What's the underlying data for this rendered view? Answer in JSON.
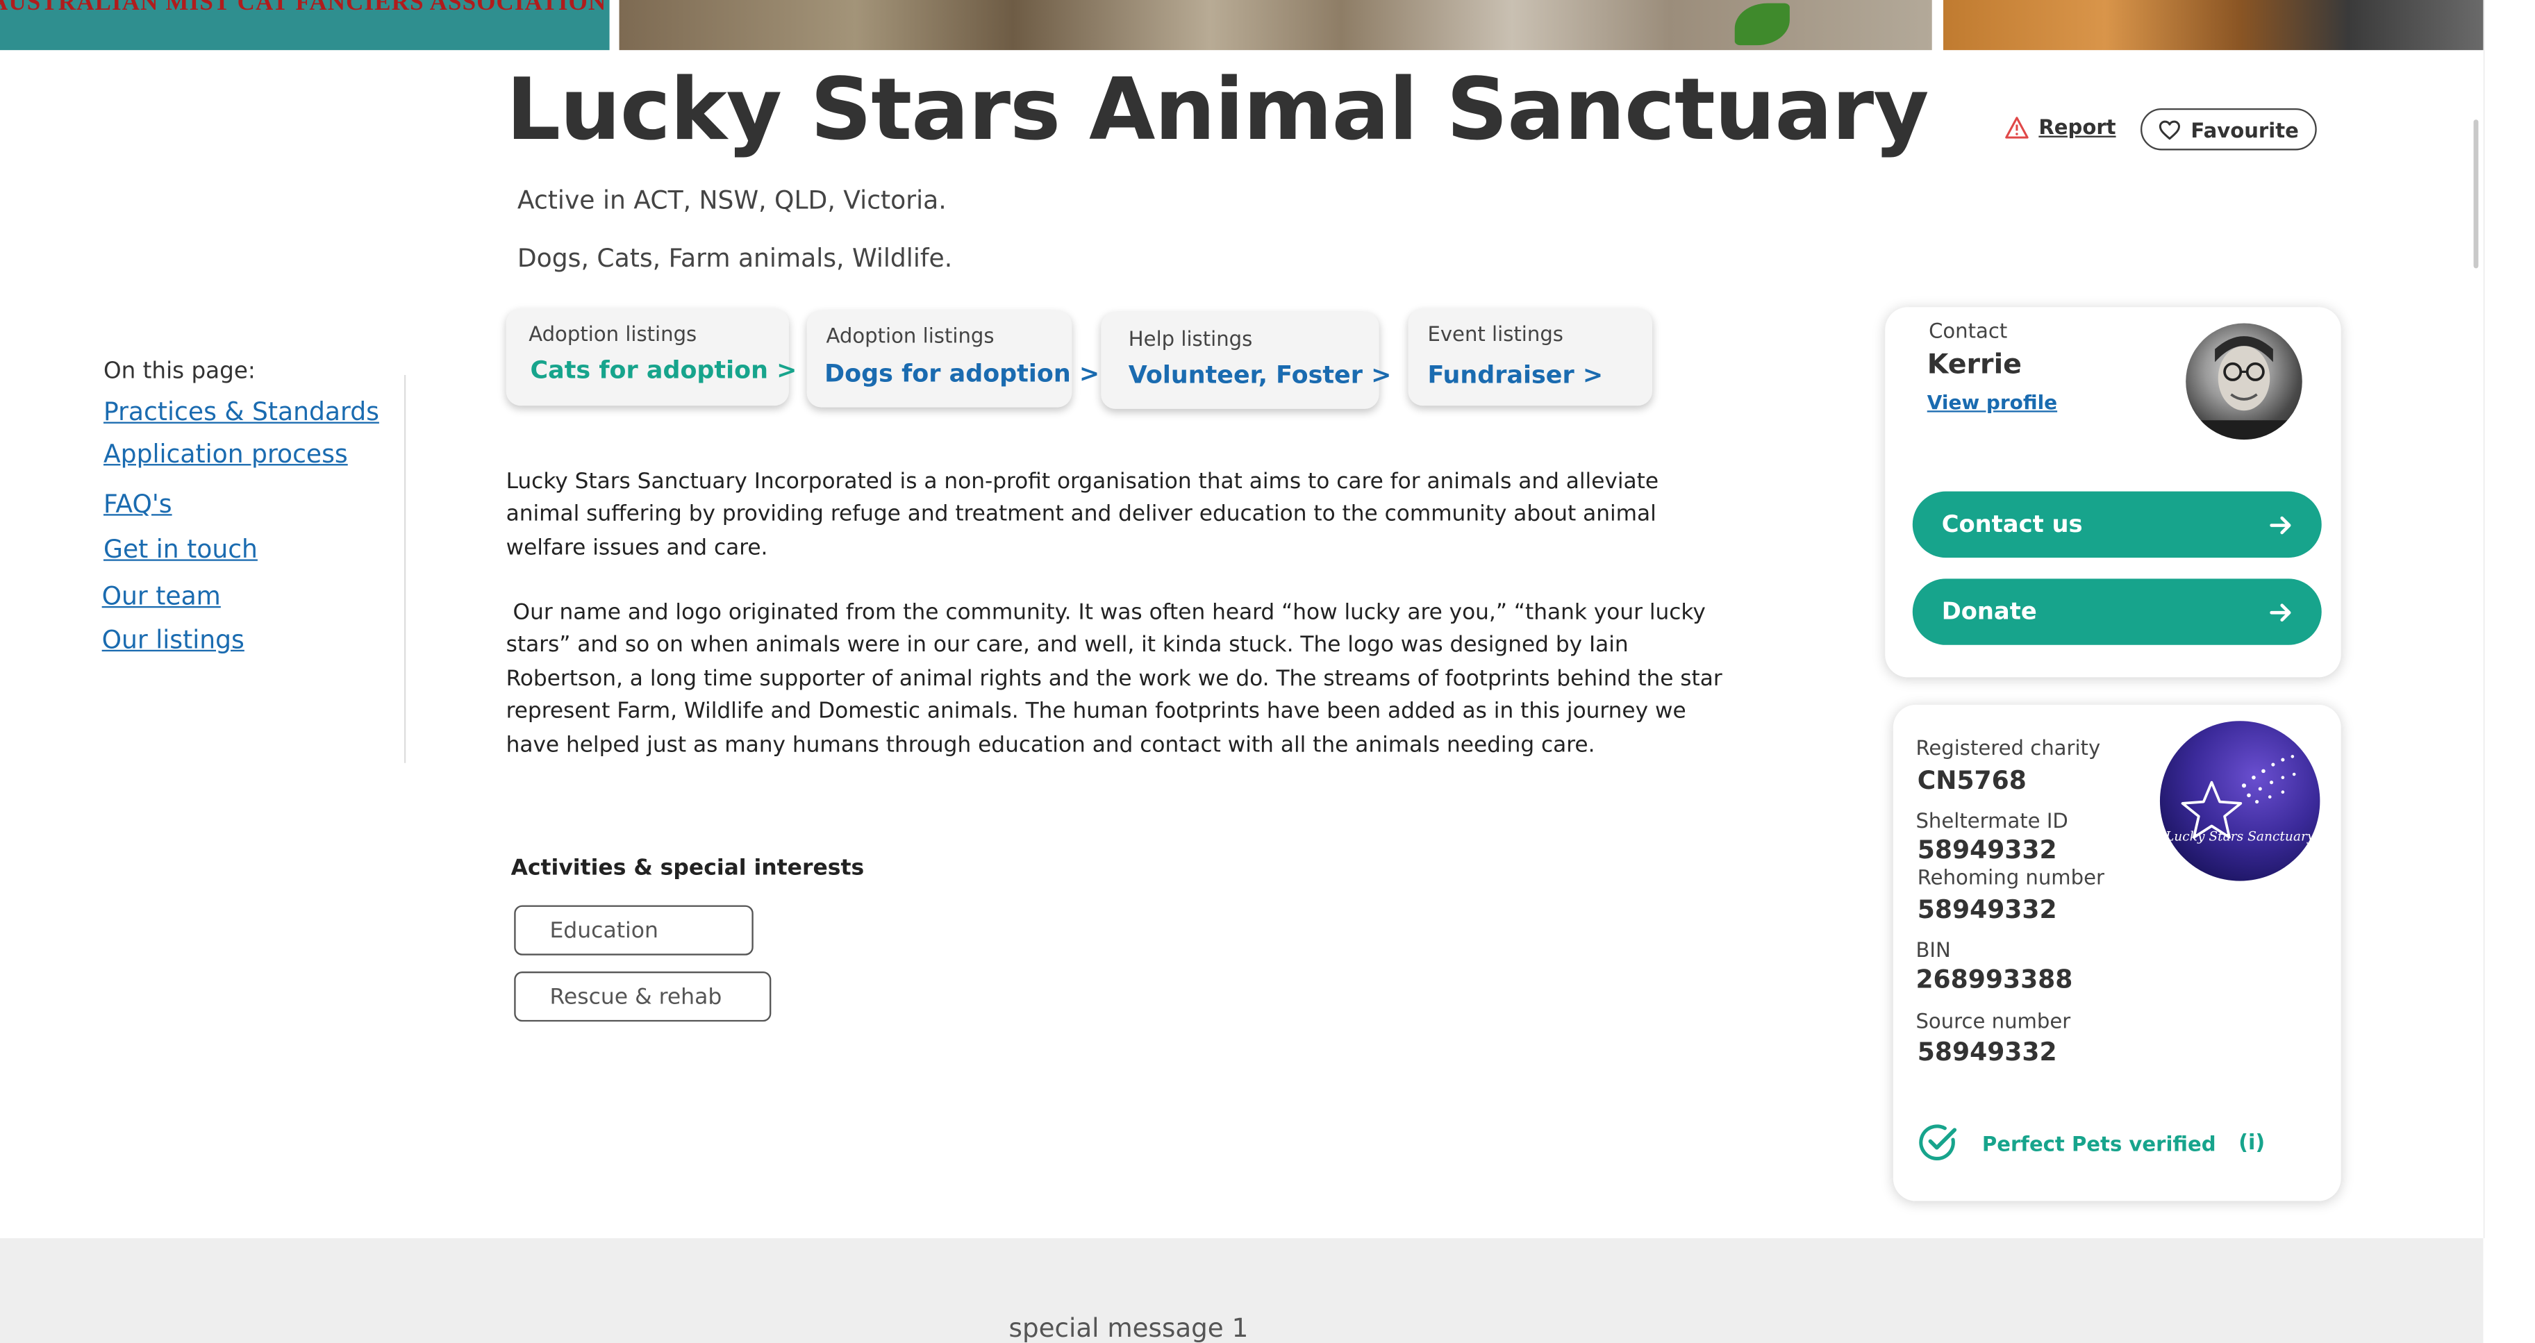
{
  "banner": {
    "association_text": "AUSTRALIAN MIST CAT FANCIERS ASSOCIATION Inc"
  },
  "header": {
    "title": "Lucky Stars Animal Sanctuary",
    "active_in": "Active in ACT, NSW, QLD, Victoria.",
    "animals": "Dogs, Cats, Farm animals, Wildlife.",
    "report_label": "Report",
    "favourite_label": "Favourite"
  },
  "nav": {
    "heading": "On this page:",
    "links": [
      "Practices & Standards",
      "Application process",
      "FAQ's",
      "Get in touch",
      "Our team",
      "Our listings"
    ]
  },
  "listings": [
    {
      "label": "Adoption listings",
      "value": "Cats for adoption >",
      "color": "#17a48c"
    },
    {
      "label": "Adoption listings",
      "value": "Dogs for adoption >",
      "color": "#1a6bb0"
    },
    {
      "label": "Help listings",
      "value": "Volunteer, Foster >",
      "color": "#1a6bb0"
    },
    {
      "label": "Event listings",
      "value": "Fundraiser >",
      "color": "#1a6bb0"
    }
  ],
  "about": {
    "paragraph1": "Lucky Stars Sanctuary Incorporated is a non-profit organisation that aims to care for animals and alleviate animal suffering by providing refuge and treatment and deliver education to the community about animal welfare issues and care.",
    "paragraph2": " Our name and logo originated from the community. It was often heard “how lucky are you,” “thank your lucky stars” and so on when animals were in our care, and well, it kinda stuck. The logo was designed by Iain Robertson, a long time supporter of animal rights and the work we do. The streams of footprints behind the star represent Farm, Wildlife and Domestic animals. The human footprints have been added as in this journey we have helped just as many humans through education and contact with all the animals needing care."
  },
  "activities": {
    "title": "Activities & special interests",
    "items": [
      "Education",
      "Rescue & rehab"
    ]
  },
  "contact": {
    "label": "Contact",
    "name": "Kerrie",
    "view_profile": "View profile",
    "contact_button": "Contact us",
    "donate_button": "Donate"
  },
  "registration": {
    "registered_charity_label": "Registered charity",
    "registered_charity_value": "CN5768",
    "sheltermate_label": "Sheltermate ID",
    "sheltermate_value": "58949332",
    "rehoming_label": "Rehoming number",
    "rehoming_value": "58949332",
    "bin_label": "BIN",
    "bin_value": "268993388",
    "source_label": "Source number",
    "source_value": "58949332",
    "logo_text": "Lucky Stars Sanctuary",
    "verified_label": "Perfect Pets verified",
    "info_label": "(i)"
  },
  "footer": {
    "special_message": "special message 1"
  },
  "colors": {
    "accent": "#17a48c",
    "link": "#1a6bb0",
    "text": "#333333"
  }
}
